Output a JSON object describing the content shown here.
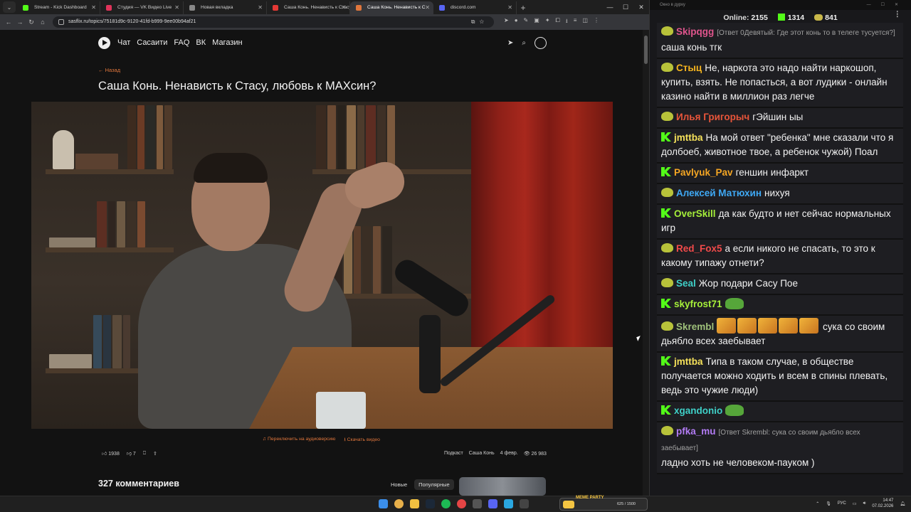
{
  "browser": {
    "tabs": [
      {
        "title": "Stream - Kick Dashboard",
        "color": "#53fc18",
        "active": false
      },
      {
        "title": "Студия — VK Видео Live",
        "color": "#e0335a",
        "active": false
      },
      {
        "title": "Новая вкладка",
        "color": "#888888",
        "active": false
      },
      {
        "title": "Саша Конь. Ненависть к Стасу",
        "color": "#e53935",
        "active": false
      },
      {
        "title": "Саша Конь. Ненависть к С",
        "color": "#e0763c",
        "active": true
      },
      {
        "title": "discord.com",
        "color": "#5865f2",
        "active": false
      }
    ],
    "url": "sasflix.ru/topics/75181d9c-9120-41fd-b999-9ee00b94af21"
  },
  "site": {
    "nav": [
      "Чат",
      "Сасаити",
      "FAQ",
      "ВК",
      "Магазин"
    ],
    "back_label": "← Назад",
    "title": "Саша Конь. Ненависть к Стасу, любовь к МАХсин?",
    "audio_link": "Переключить на аудиоверсию",
    "download_link": "Скачать видео",
    "likes": "1938",
    "dislikes": "7",
    "tag_podcast": "Подкаст",
    "tag_guest": "Саша Конь",
    "date": "4 февр.",
    "views": "26 983",
    "comments_title": "327 комментариев",
    "sort_new": "Новые",
    "sort_popular": "Популярные"
  },
  "chat": {
    "window_title": "Окно в дурку",
    "online_label": "Online:",
    "online_value": "2155",
    "kick_count": "1314",
    "vk_count": "841",
    "messages": [
      {
        "badge": "pepe",
        "nick": "Skipqgg",
        "color": "#e0558d",
        "reply": "[Ответ 0Девятый: Где этот конь то в телеге тусуется?]",
        "text": "саша конь тгк"
      },
      {
        "badge": "pepe",
        "nick": "Стыц",
        "color": "#f5b41e",
        "text": "Не, наркота это надо найти наркошоп, купить, взять. Не попасться, а вот лудики - онлайн казино найти в миллион раз легче"
      },
      {
        "badge": "pepe",
        "nick": "Илья Григорыч",
        "color": "#e8553a",
        "text": "гЭйшин ыы"
      },
      {
        "badge": "kick",
        "nick": "jmttba",
        "color": "#f5e15a",
        "text": "На мой ответ \"ребенка\" мне сказали что я долбоеб, животное твое, а ребенок чужой) Поал"
      },
      {
        "badge": "kick",
        "nick": "Pavlyuk_Pav",
        "color": "#f5a623",
        "text": "геншин инфаркт"
      },
      {
        "badge": "pepe",
        "nick": "Алексей Матюхин",
        "color": "#3fa9f5",
        "text": "нихуя"
      },
      {
        "badge": "kick",
        "nick": "OverSkill",
        "color": "#a6f03a",
        "text": "да как будто и нет сейчас нормальных игр"
      },
      {
        "badge": "pepe",
        "nick": "Red_Fox5",
        "color": "#f24a4a",
        "text": "а если никого не спасать, то это к какому типажу отнети?"
      },
      {
        "badge": "pepe",
        "nick": "Seal",
        "color": "#3fd0c8",
        "text": "Жор подари Сасу Пое"
      },
      {
        "badge": "kick",
        "nick": "skyfrost71",
        "color": "#a6f03a",
        "text": "",
        "emotes": 1
      },
      {
        "badge": "pepe",
        "nick": "Skrembl",
        "color": "#9ec07a",
        "text": "сука со своим дьябло всех заебывает",
        "emotes_gold": 5
      },
      {
        "badge": "kick",
        "nick": "jmttba",
        "color": "#f5e15a",
        "text": "Типа в таком случае, в обществе получается можно ходить и всем в спины плевать, ведь это чужие люди)"
      },
      {
        "badge": "kick",
        "nick": "xgandonio",
        "color": "#3fd0c8",
        "text": "",
        "emotes": 1
      },
      {
        "badge": "pepe",
        "nick": "pfka_mu",
        "color": "#b37cf5",
        "reply": "[Ответ Skrembl: сука со своим дьябло всех заебывает]",
        "text": "ладно хоть не человеком-пауком )"
      }
    ]
  },
  "taskbar": {
    "meme_label": "MEME PARTY",
    "meme_value": "625 / 1500",
    "lang": "РУС",
    "time": "14:47",
    "date": "07.02.2026"
  }
}
